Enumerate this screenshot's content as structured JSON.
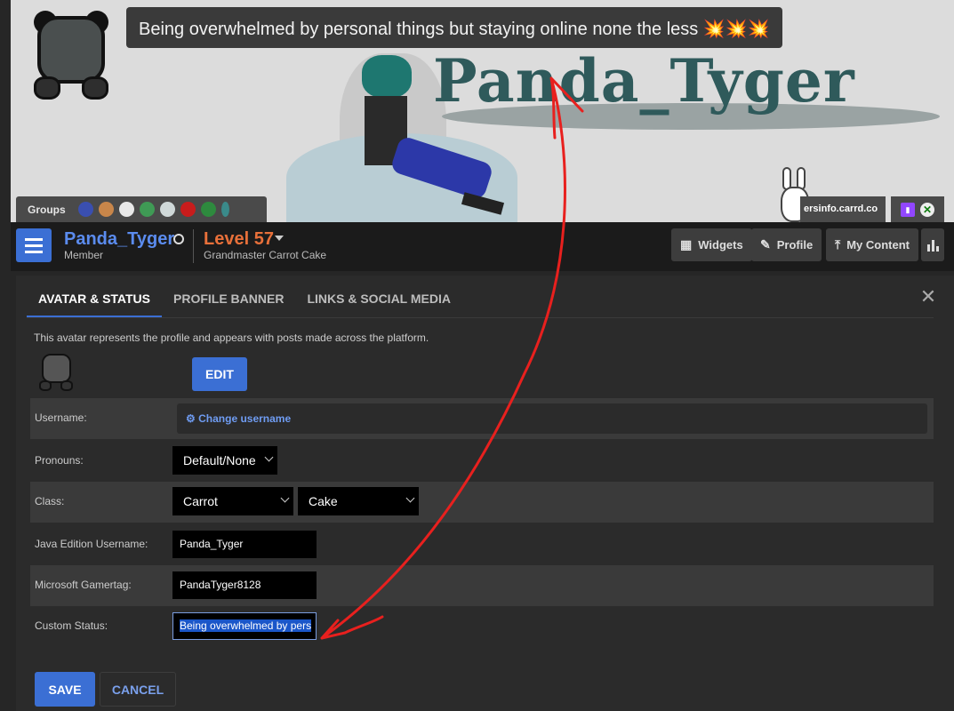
{
  "banner": {
    "status_text": "Being overwhelmed by personal things but staying online none the less 💥💥💥",
    "logo_text": "Panda_Tyger",
    "groups_label": "Groups",
    "url_text": "ersinfo.carrd.co",
    "twitch_icon": "twitch-icon",
    "xbox_icon": "xbox-icon"
  },
  "header": {
    "username": "Panda_Tyger",
    "role": "Member",
    "level": "Level 57",
    "level_title": "Grandmaster Carrot Cake",
    "buttons": {
      "widgets": "Widgets",
      "profile": "Profile",
      "my_content": "My Content"
    }
  },
  "tabs": [
    {
      "label": "Avatar & Status",
      "active": true
    },
    {
      "label": "Profile Banner",
      "active": false
    },
    {
      "label": "Links & Social Media",
      "active": false
    }
  ],
  "avatar_section": {
    "description": "This avatar represents the profile and appears with posts made across the platform.",
    "edit_label": "EDIT"
  },
  "form": {
    "username_label": "Username:",
    "change_username": "Change username",
    "pronouns_label": "Pronouns:",
    "pronouns_value": "Default/None",
    "class_label": "Class:",
    "class_value_1": "Carrot",
    "class_value_2": "Cake",
    "java_label": "Java Edition Username:",
    "java_value": "Panda_Tyger",
    "gamertag_label": "Microsoft Gamertag:",
    "gamertag_value": "PandaTyger8128",
    "status_label": "Custom Status:",
    "status_value": "Being overwhelmed by personal things but staying online none the less 💥💥💥",
    "status_visible": "Being overwhelmed by pers"
  },
  "actions": {
    "save": "SAVE",
    "cancel": "CANCEL"
  },
  "colors": {
    "accent": "#3b6fd4",
    "username": "#5b8cef",
    "level": "#e8703a",
    "annotation": "#e8201e"
  }
}
